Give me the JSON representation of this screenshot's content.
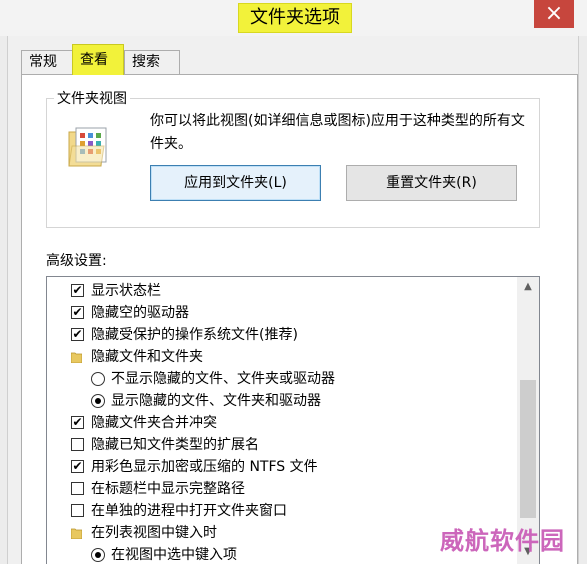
{
  "window": {
    "title": "文件夹选项",
    "close_glyph": "×"
  },
  "tabs": [
    {
      "label": "常规"
    },
    {
      "label": "查看"
    },
    {
      "label": "搜索"
    }
  ],
  "folder_view": {
    "group_title": "文件夹视图",
    "description": "你可以将此视图(如详细信息或图标)应用于这种类型的所有文件夹。",
    "apply_button": "应用到文件夹(L)",
    "reset_button": "重置文件夹(R)",
    "icon": "folder-view-icon"
  },
  "advanced": {
    "label": "高级设置:",
    "items": [
      {
        "kind": "checkbox",
        "checked": true,
        "label": "显示状态栏"
      },
      {
        "kind": "checkbox",
        "checked": true,
        "label": "隐藏空的驱动器"
      },
      {
        "kind": "checkbox",
        "checked": true,
        "label": "隐藏受保护的操作系统文件(推荐)"
      },
      {
        "kind": "folder",
        "label": "隐藏文件和文件夹"
      },
      {
        "kind": "radio",
        "checked": false,
        "label": "不显示隐藏的文件、文件夹或驱动器"
      },
      {
        "kind": "radio",
        "checked": true,
        "label": "显示隐藏的文件、文件夹和驱动器"
      },
      {
        "kind": "checkbox",
        "checked": true,
        "label": "隐藏文件夹合并冲突"
      },
      {
        "kind": "checkbox",
        "checked": false,
        "label": "隐藏已知文件类型的扩展名"
      },
      {
        "kind": "checkbox",
        "checked": true,
        "label": "用彩色显示加密或压缩的 NTFS 文件"
      },
      {
        "kind": "checkbox",
        "checked": false,
        "label": "在标题栏中显示完整路径"
      },
      {
        "kind": "checkbox",
        "checked": false,
        "label": "在单独的进程中打开文件夹窗口"
      },
      {
        "kind": "folder",
        "label": "在列表视图中键入时"
      },
      {
        "kind": "radio",
        "checked": true,
        "label": "在视图中选中键入项"
      }
    ]
  },
  "scrollbar": {
    "up_glyph": "▲",
    "down_glyph": "▼"
  },
  "watermark": "威航软件园",
  "colors": {
    "highlight": "#f2f23a",
    "close": "#c7463d",
    "watermark": "#cc66bb"
  }
}
